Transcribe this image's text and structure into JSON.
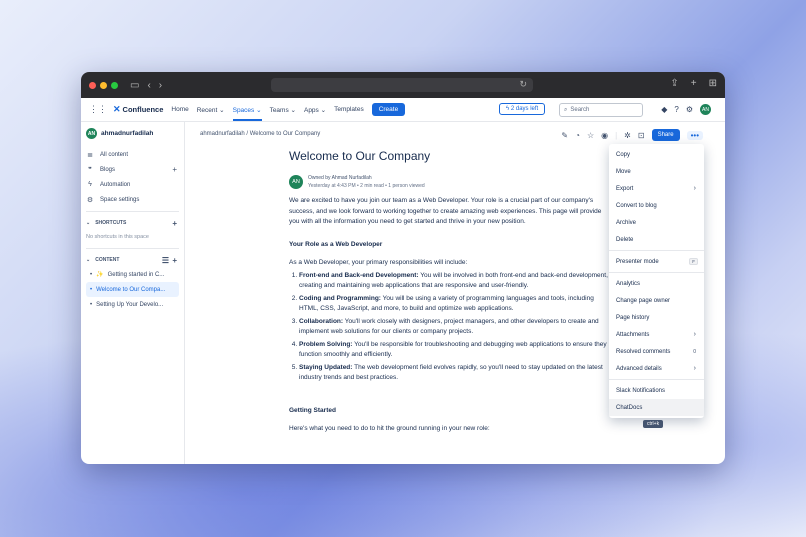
{
  "window": {
    "url_bar": ""
  },
  "topnav": {
    "product": "Confluence",
    "links": [
      "Home",
      "Recent",
      "Spaces",
      "Teams",
      "Apps",
      "Templates"
    ],
    "create_label": "Create",
    "trial_label": "2 days left",
    "search_placeholder": "Search",
    "avatar_initials": "AN"
  },
  "sidebar": {
    "user_name": "ahmadnurfadilah",
    "avatar_initials": "AN",
    "items": [
      "All content",
      "Blogs",
      "Automation",
      "Space settings"
    ],
    "shortcuts_label": "SHORTCUTS",
    "shortcuts_empty": "No shortcuts in this space",
    "content_label": "CONTENT",
    "pages": [
      "Getting started in C...",
      "Welcome to Our Compa...",
      "Setting Up Your Develo..."
    ]
  },
  "content": {
    "breadcrumb_space": "ahmadnurfadilah",
    "breadcrumb_sep": "/",
    "breadcrumb_page": "Welcome to Our Company",
    "share_label": "Share",
    "more_label": "•••"
  },
  "doc": {
    "title": "Welcome to Our Company",
    "avatar_initials": "AN",
    "owner": "Owned by Ahmad Nurfadilah",
    "meta": "Yesterday at 4:43 PM • 2 min read • 1 person viewed",
    "intro": "We are excited to have you join our team as a Web Developer. Your role is a crucial part of our company's success, and we look forward to working together to create amazing web experiences. This page will provide you with all the information you need to get started and thrive in your new position.",
    "role_heading": "Your Role as a Web Developer",
    "role_intro": "As a Web Developer, your primary responsibilities will include:",
    "responsibilities": [
      {
        "title": "Front-end and Back-end Development:",
        "text": " You will be involved in both front-end and back-end development, creating and maintaining web applications that are responsive and user-friendly."
      },
      {
        "title": "Coding and Programming:",
        "text": " You will be using a variety of programming languages and tools, including HTML, CSS, JavaScript, and more, to build and optimize web applications."
      },
      {
        "title": "Collaboration:",
        "text": " You'll work closely with designers, project managers, and other developers to create and implement web solutions for our clients or company projects."
      },
      {
        "title": "Problem Solving:",
        "text": " You'll be responsible for troubleshooting and debugging web applications to ensure they function smoothly and efficiently."
      },
      {
        "title": "Staying Updated:",
        "text": " The web development field evolves rapidly, so you'll need to stay updated on the latest industry trends and best practices."
      }
    ],
    "getting_started_heading": "Getting Started",
    "getting_started_intro": "Here's what you need to do to hit the ground running in your new role:"
  },
  "menu": {
    "group1": [
      "Copy",
      "Move",
      "Export",
      "Convert to blog",
      "Archive",
      "Delete"
    ],
    "presenter": "Presenter mode",
    "presenter_key": "F",
    "group3": [
      "Analytics",
      "Change page owner",
      "Page history",
      "Attachments",
      "Resolved comments",
      "Advanced details"
    ],
    "resolved_count": "0",
    "group4": [
      "Slack Notifications",
      "ChatDocs"
    ],
    "tooltip": "ctrl+k"
  }
}
